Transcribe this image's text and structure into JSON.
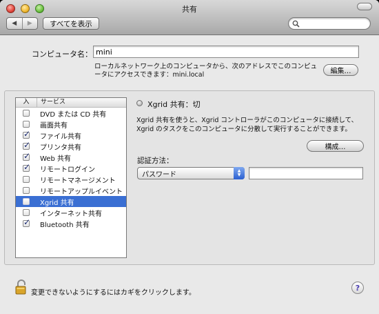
{
  "window": {
    "title": "共有"
  },
  "toolbar": {
    "back_icon": "◀",
    "forward_icon": "▶",
    "show_all_label": "すべてを表示",
    "search_value": ""
  },
  "computer": {
    "label": "コンピュータ名：",
    "name_value": "mini",
    "description": "ローカルネットワーク上のコンピュータから、次のアドレスでこのコンピュータにアクセスできます：mini.local",
    "edit_label": "編集…"
  },
  "services": {
    "col_on": "入",
    "col_service": "サービス",
    "items": [
      {
        "label": "DVD または CD 共有",
        "checked": false,
        "selected": false
      },
      {
        "label": "画面共有",
        "checked": false,
        "selected": false
      },
      {
        "label": "ファイル共有",
        "checked": true,
        "selected": false
      },
      {
        "label": "プリンタ共有",
        "checked": true,
        "selected": false
      },
      {
        "label": "Web 共有",
        "checked": true,
        "selected": false
      },
      {
        "label": "リモートログイン",
        "checked": true,
        "selected": false
      },
      {
        "label": "リモートマネージメント",
        "checked": false,
        "selected": false
      },
      {
        "label": "リモートアップルイベント",
        "checked": false,
        "selected": false
      },
      {
        "label": "Xgrid 共有",
        "checked": false,
        "selected": true
      },
      {
        "label": "インターネット共有",
        "checked": false,
        "selected": false
      },
      {
        "label": "Bluetooth 共有",
        "checked": true,
        "selected": false
      }
    ]
  },
  "detail": {
    "status": "Xgrid 共有：切",
    "description": "Xgrid 共有を使うと、Xgrid コントローラがこのコンピュータに接続して、Xgrid のタスクをこのコンピュータに分散して実行することができます。",
    "configure_label": "構成…",
    "auth_label": "認証方法：",
    "auth_value": "パスワード",
    "password_value": ""
  },
  "footer": {
    "lock_text": "変更できないようにするにはカギをクリックします。",
    "help_label": "?"
  }
}
